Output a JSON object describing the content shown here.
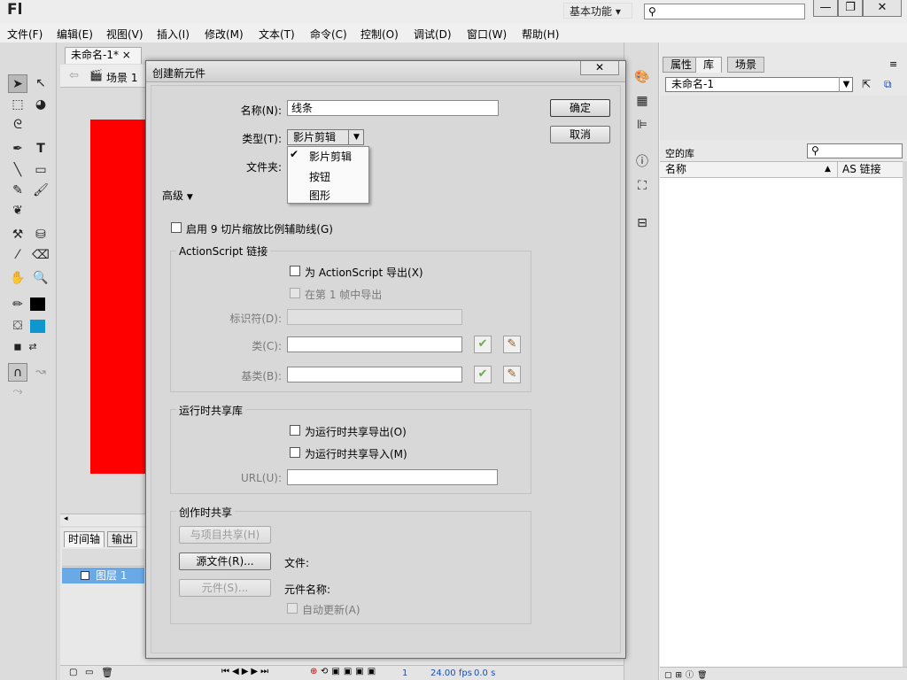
{
  "app": {
    "logo": "Fl",
    "workspace": "基本功能",
    "workspace_arrow": "▾",
    "search_placeholder": "",
    "search_glyph": "⚲"
  },
  "window_controls": {
    "minimize": "—",
    "restore": "❐",
    "close": "✕"
  },
  "menu": [
    "文件(F)",
    "编辑(E)",
    "视图(V)",
    "插入(I)",
    "修改(M)",
    "文本(T)",
    "命令(C)",
    "控制(O)",
    "调试(D)",
    "窗口(W)",
    "帮助(H)"
  ],
  "document": {
    "tab_label": "未命名-1*",
    "tab_close": "×",
    "scene_label": "场景 1"
  },
  "timeline": {
    "tab_timeline": "时间轴",
    "tab_output": "输出",
    "layer_name": "图层 1"
  },
  "status": {
    "frame": "1",
    "fps": "24.00",
    "fps_unit": "fps",
    "time": "0.0 s"
  },
  "right_panel": {
    "tabs": [
      "属性",
      "库",
      "场景"
    ],
    "doc_name": "未命名-1",
    "empty_library": "空的库",
    "col_name": "名称",
    "col_linkage": "AS 链接"
  },
  "dialog": {
    "title": "创建新元件",
    "name_label": "名称(N):",
    "name_value": "线条",
    "type_label": "类型(T):",
    "type_value": "影片剪辑",
    "folder_label": "文件夹:",
    "advanced_label": "高级",
    "advanced_arrow": "▼",
    "ok": "确定",
    "cancel": "取消",
    "dropdown_items": [
      "影片剪辑",
      "按钮",
      "图形"
    ],
    "dropdown_check": "✔",
    "nine_slice": "启用 9 切片缩放比例辅助线(G)",
    "as_group": "ActionScript 链接",
    "export_as": "为 ActionScript 导出(X)",
    "export_frame1": "在第 1 帧中导出",
    "identifier_label": "标识符(D):",
    "class_label": "类(C):",
    "base_class_label": "基类(B):",
    "runtime_group": "运行时共享库",
    "runtime_export": "为运行时共享导出(O)",
    "runtime_import": "为运行时共享导入(M)",
    "url_label": "URL(U):",
    "author_group": "创作时共享",
    "share_project": "与项目共享(H)",
    "source_file": "源文件(R)...",
    "file_label": "文件:",
    "symbol_btn": "元件(S)...",
    "symbol_name_label": "元件名称:",
    "auto_update": "自动更新(A)"
  }
}
